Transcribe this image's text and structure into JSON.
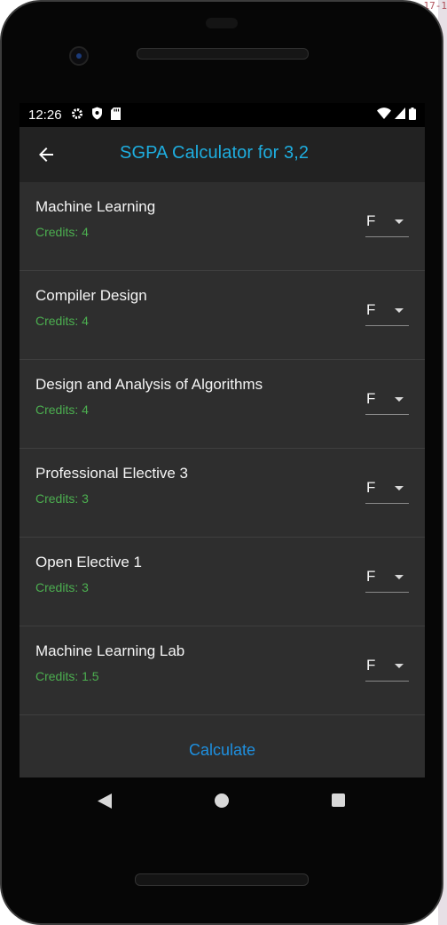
{
  "background": {
    "corner_text": "17-1"
  },
  "statusbar": {
    "time": "12:26"
  },
  "appbar": {
    "title": "SGPA Calculator for 3,2"
  },
  "subjects": [
    {
      "name": "Machine Learning",
      "credits": "Credits: 4",
      "grade": "F"
    },
    {
      "name": "Compiler Design",
      "credits": "Credits: 4",
      "grade": "F"
    },
    {
      "name": "Design and Analysis of Algorithms",
      "credits": "Credits: 4",
      "grade": "F"
    },
    {
      "name": "Professional Elective 3",
      "credits": "Credits: 3",
      "grade": "F"
    },
    {
      "name": "Open Elective 1",
      "credits": "Credits: 3",
      "grade": "F"
    },
    {
      "name": "Machine Learning Lab",
      "credits": "Credits: 1.5",
      "grade": "F"
    }
  ],
  "actions": {
    "calculate_label": "Calculate"
  },
  "colors": {
    "title": "#1eaee0",
    "credits": "#4caf50",
    "button": "#1e90e0",
    "surface": "#2e2e2e",
    "appbar": "#222222"
  }
}
